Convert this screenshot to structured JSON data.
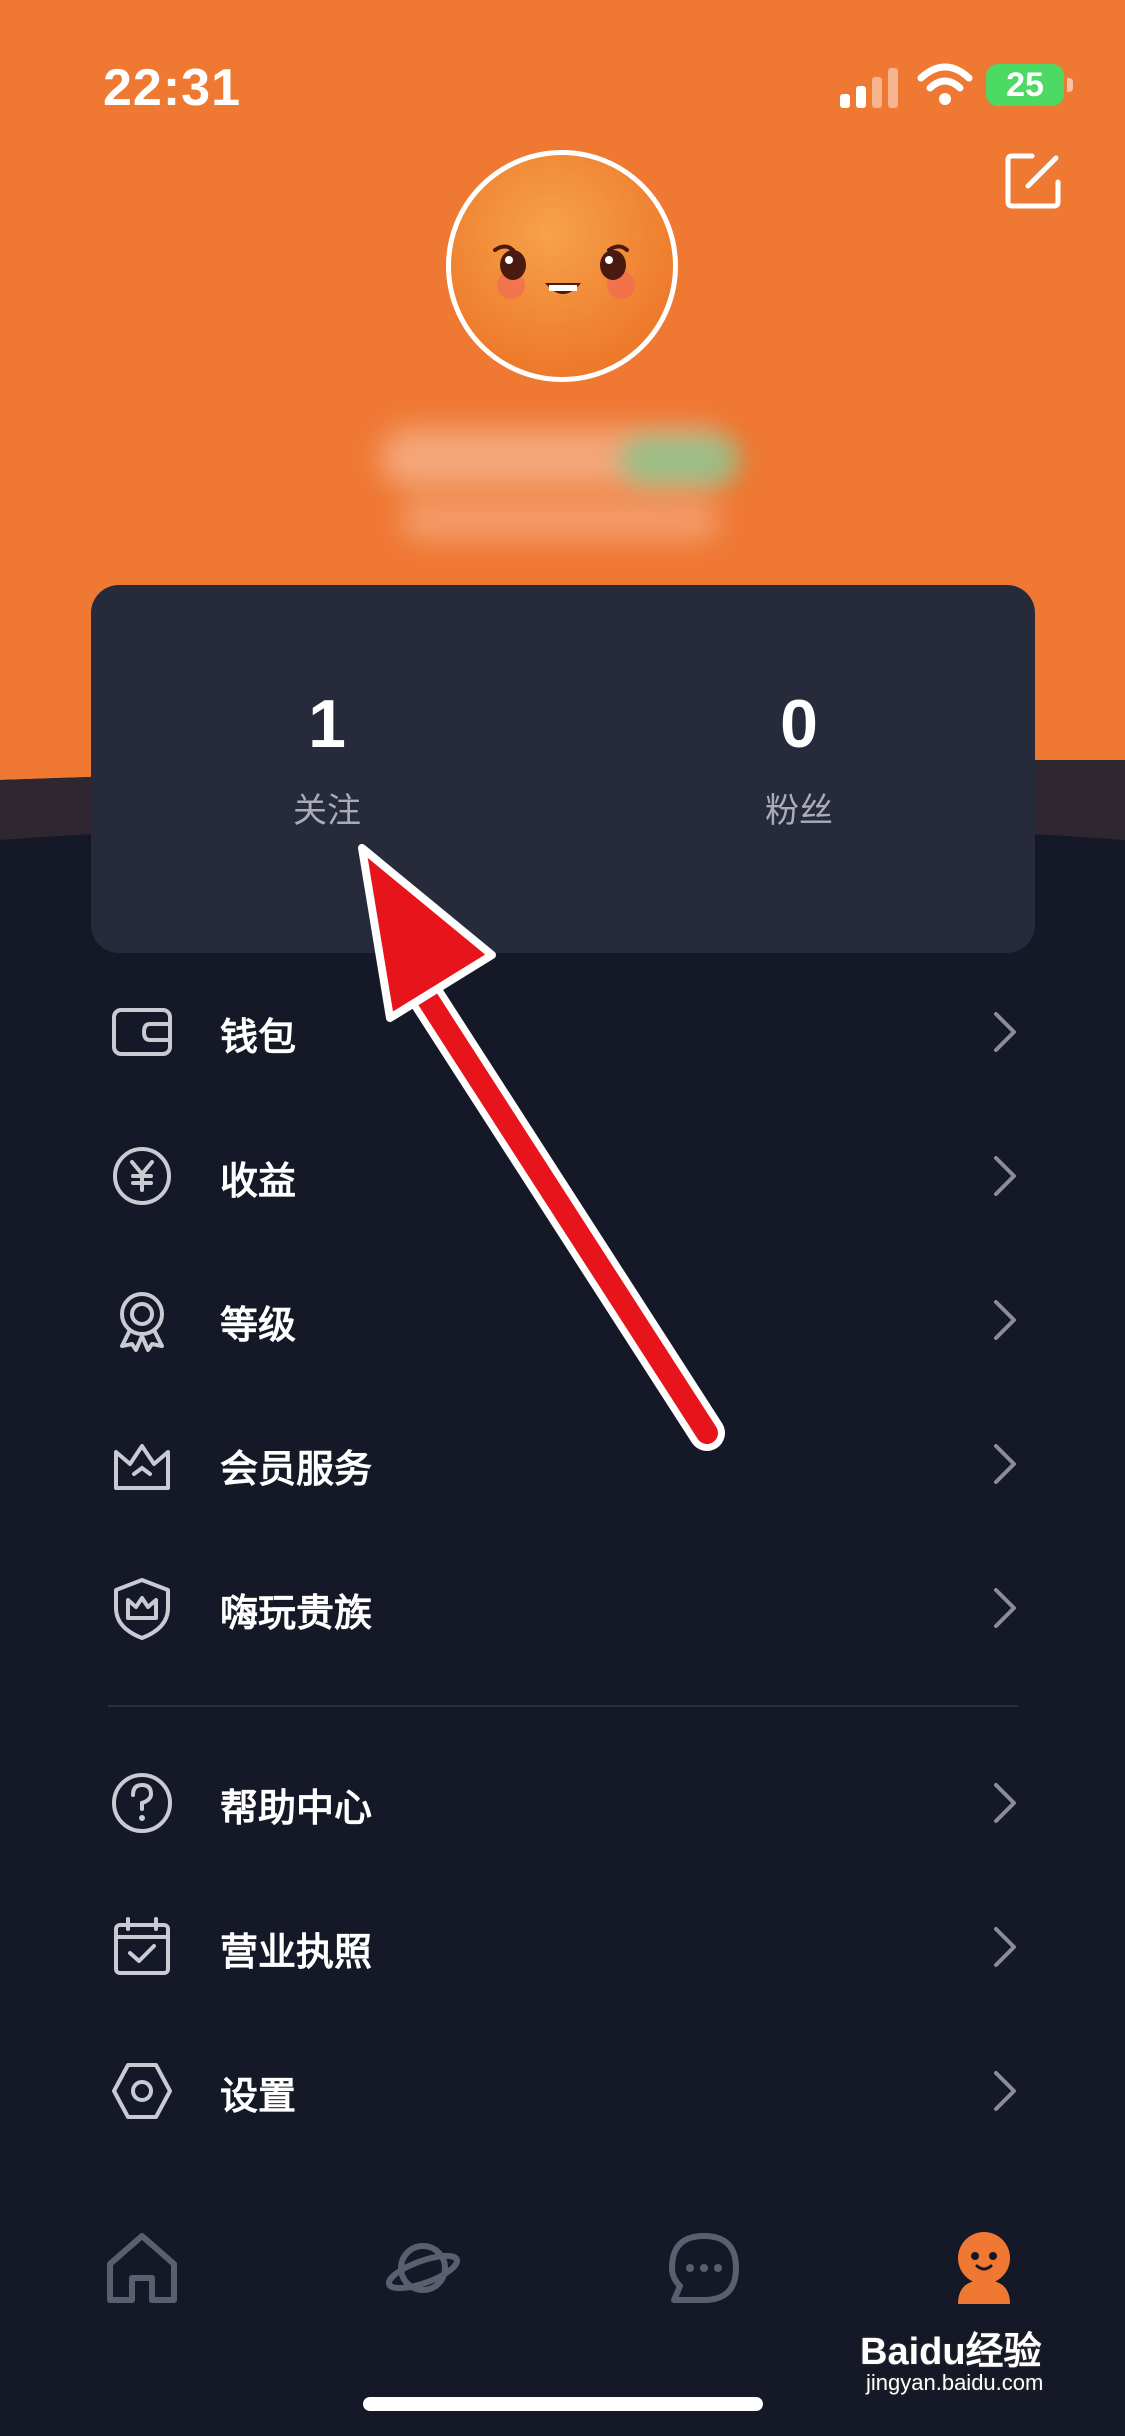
{
  "status_bar": {
    "time": "22:31",
    "battery": "25"
  },
  "profile": {
    "avatar": "avatar-image"
  },
  "stats": [
    {
      "value": "1",
      "label": "关注"
    },
    {
      "value": "0",
      "label": "粉丝"
    }
  ],
  "menu": [
    {
      "label": "钱包",
      "icon": "wallet-icon"
    },
    {
      "label": "收益",
      "icon": "yen-icon"
    },
    {
      "label": "等级",
      "icon": "medal-icon"
    },
    {
      "label": "会员服务",
      "icon": "crown-icon"
    },
    {
      "label": "嗨玩贵族",
      "icon": "shield-crown-icon"
    },
    {
      "label": "帮助中心",
      "icon": "help-icon"
    },
    {
      "label": "营业执照",
      "icon": "calendar-check-icon"
    },
    {
      "label": "设置",
      "icon": "hexagon-settings-icon"
    }
  ],
  "tabs": [
    "home-icon",
    "planet-icon",
    "chat-icon",
    "profile-icon"
  ],
  "watermark": {
    "brand": "Baidu经验",
    "url": "jingyan.baidu.com"
  },
  "colors": {
    "accent": "#EE7830",
    "background": "#151826",
    "card": "#262A3B",
    "arrow": "#E8141C"
  }
}
